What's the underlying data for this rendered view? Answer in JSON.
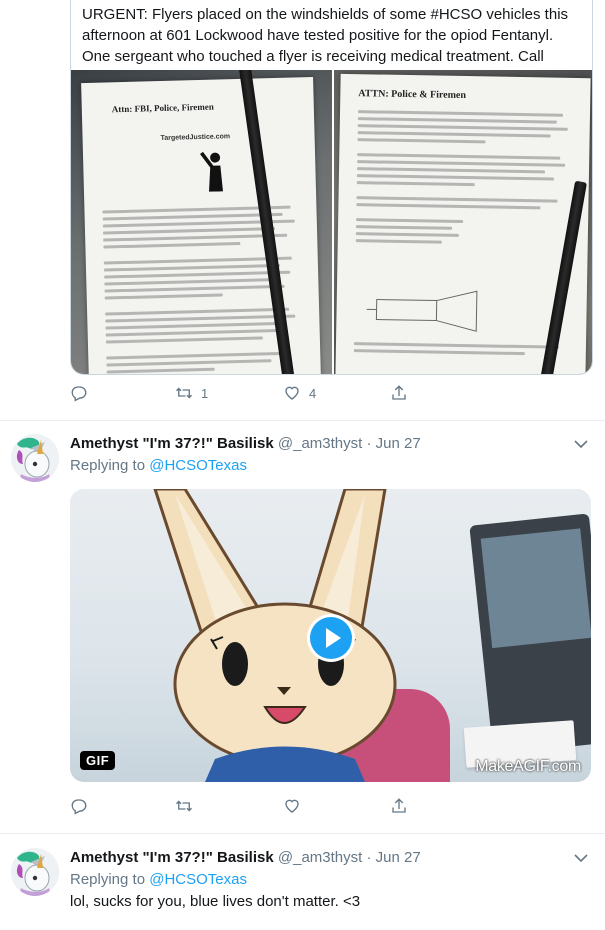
{
  "quoted_tweet": {
    "text": "URGENT: Flyers placed on the windshields of some #HCSO vehicles this afternoon at 601 Lockwood have tested positive for the opiod Fentanyl. One sergeant who touched a flyer is receiving medical treatment. Call",
    "image_left": {
      "title": "Attn: FBI, Police, Firemen",
      "site": "TargetedJustice.com"
    },
    "image_right": {
      "title": "ATTN: Police & Firemen"
    },
    "actions": {
      "reply_icon": "reply-icon",
      "retweet_count": "1",
      "like_count": "4",
      "share_icon": "share-icon"
    }
  },
  "tweets": [
    {
      "display_name": "Amethyst \"I'm 37?!\" Basilisk",
      "handle": "@_am3thyst",
      "separator": "·",
      "timestamp": "Jun 27",
      "replying_label": "Replying to",
      "replying_to": "@HCSOTexas",
      "media": {
        "badge": "GIF",
        "watermark": "MakeAGIF.com"
      },
      "actions": {
        "retweet_count": "",
        "like_count": ""
      }
    },
    {
      "display_name": "Amethyst \"I'm 37?!\" Basilisk",
      "handle": "@_am3thyst",
      "separator": "·",
      "timestamp": "Jun 27",
      "replying_label": "Replying to",
      "replying_to": "@HCSOTexas",
      "text": "lol, sucks for you, blue lives don't matter. <3"
    }
  ],
  "colors": {
    "accent": "#1da1f2",
    "secondary_text": "#657786",
    "divider": "#e6ecf0"
  }
}
